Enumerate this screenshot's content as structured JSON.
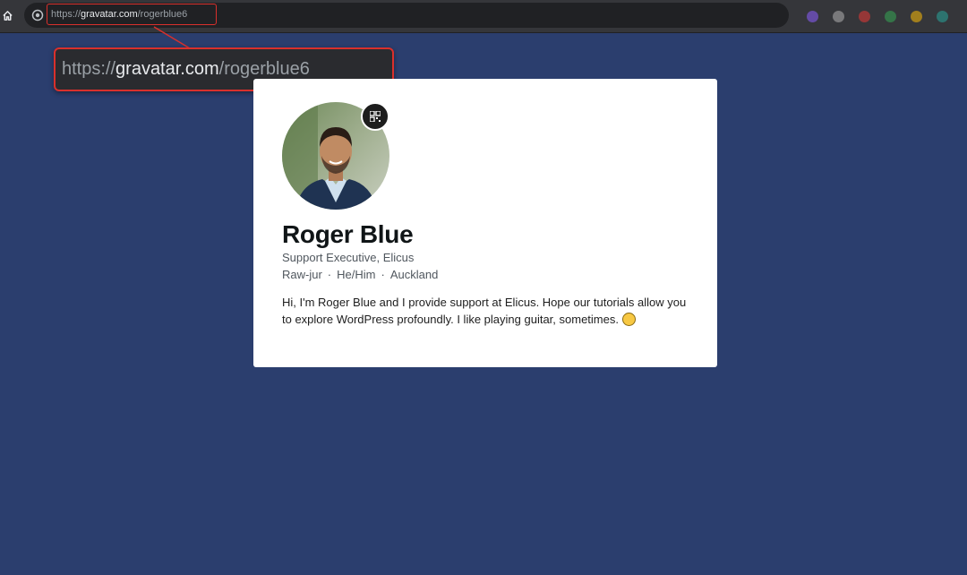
{
  "browser": {
    "url_scheme": "https://",
    "url_host": "gravatar.com",
    "url_path": "/rogerblue6",
    "zoom_scheme": "https://",
    "zoom_host": "gravatar.com",
    "zoom_path": "/rogerblue6"
  },
  "extensions": [
    {
      "icon": "purple-extension-icon",
      "color": "#8a5cff"
    },
    {
      "icon": "pen-extension-icon",
      "color": "#b0b0b0"
    },
    {
      "icon": "red-extension-icon",
      "color": "#e53935"
    },
    {
      "icon": "green-extension-icon",
      "color": "#34a853"
    },
    {
      "icon": "multicolor-extension-icon",
      "color": "#fbbc05"
    },
    {
      "icon": "teal-extension-icon",
      "color": "#26a69a"
    },
    {
      "icon": "grey-extension-icon",
      "color": "#9e9e9e"
    }
  ],
  "profile": {
    "name": "Roger Blue",
    "job": "Support Executive, Elicus",
    "pronunciation": "Raw-jur",
    "pronouns": "He/Him",
    "location": "Auckland",
    "separator": "·",
    "bio": "Hi, I'm Roger Blue and I provide support at Elicus. Hope our tutorials allow you to explore WordPress profoundly. I like playing guitar, sometimes."
  },
  "colors": {
    "page_background": "#2b3e6e",
    "highlight": "#d9302c"
  }
}
